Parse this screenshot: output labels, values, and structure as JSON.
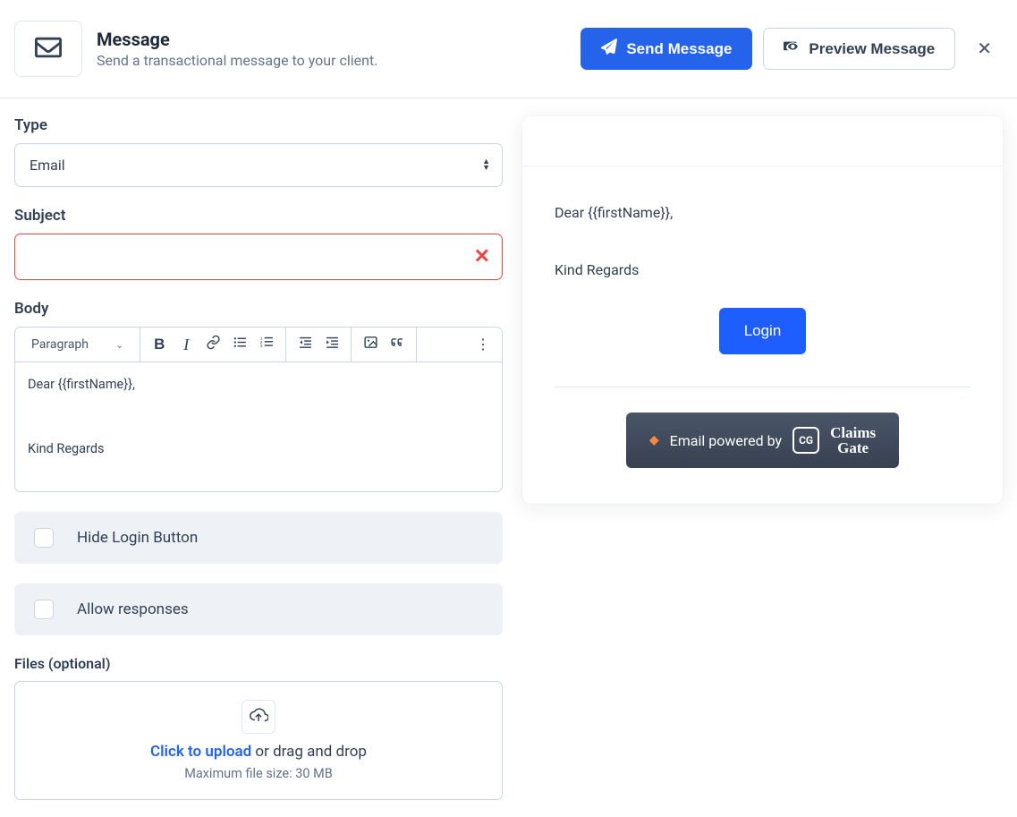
{
  "header": {
    "title": "Message",
    "subtitle": "Send a transactional message to your client.",
    "send_label": "Send Message",
    "preview_label": "Preview Message"
  },
  "form": {
    "type_label": "Type",
    "type_value": "Email",
    "subject_label": "Subject",
    "subject_value": "",
    "body_label": "Body",
    "para_style": "Paragraph",
    "body_line1": "Dear {{firstName}},",
    "body_line2": "Kind Regards",
    "hide_login_label": "Hide Login Button",
    "allow_responses_label": "Allow responses",
    "files_label": "Files (optional)",
    "dz_link": "Click to upload",
    "dz_rest": " or drag and drop",
    "dz_sub": "Maximum file size: 30 MB"
  },
  "preview": {
    "greeting": "Dear {{firstName}},",
    "signoff": "Kind Regards",
    "login_label": "Login",
    "powered_text": "Email powered by",
    "brand1": "Claims",
    "brand2": "Gate",
    "brand_badge": "CG"
  }
}
